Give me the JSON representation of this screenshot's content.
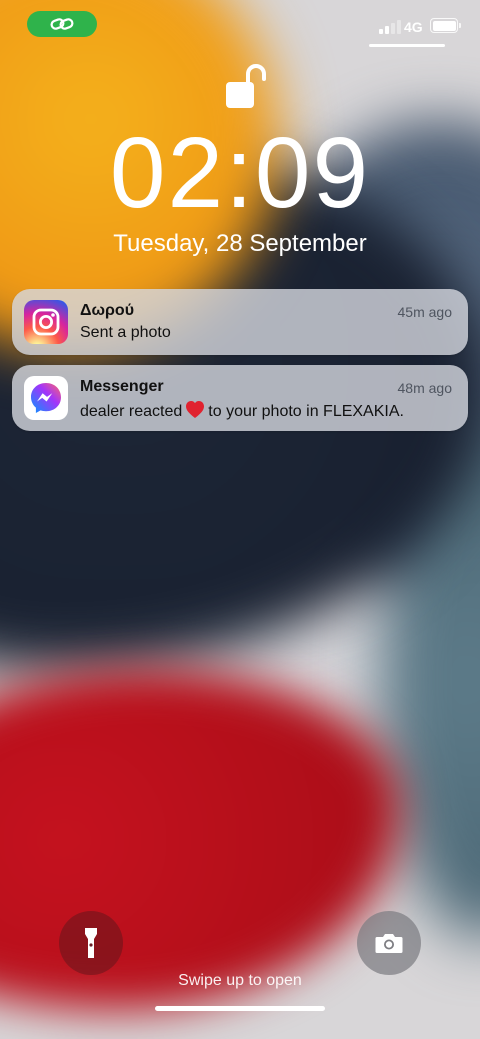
{
  "status_bar": {
    "network": "4G",
    "icons": [
      "link-icon",
      "signal-icon",
      "battery-icon"
    ],
    "link_pill_color": "#2fb34b"
  },
  "lock_screen": {
    "time": "02:09",
    "date": "Tuesday, 28 September",
    "lock_icon": "unlocked-padlock-icon"
  },
  "notifications": [
    {
      "app_icon": "instagram-icon",
      "title": "Δωρού",
      "time": "45m ago",
      "body": "Sent a photo"
    },
    {
      "app_icon": "messenger-icon",
      "title": "Messenger",
      "time": "48m ago",
      "body_before": "dealer reacted",
      "body_emoji": "heart-icon",
      "body_after": "to your photo in FLEXAKIA."
    }
  ],
  "bottom": {
    "left_button_icon": "flashlight-icon",
    "right_button_icon": "camera-icon",
    "hint": "Swipe up to open"
  },
  "colors": {
    "wallpaper_yellow": "#f4b21c",
    "wallpaper_navy": "#1b2333",
    "wallpaper_red": "#c5121f",
    "notification_bg": "#d6d8e0"
  }
}
